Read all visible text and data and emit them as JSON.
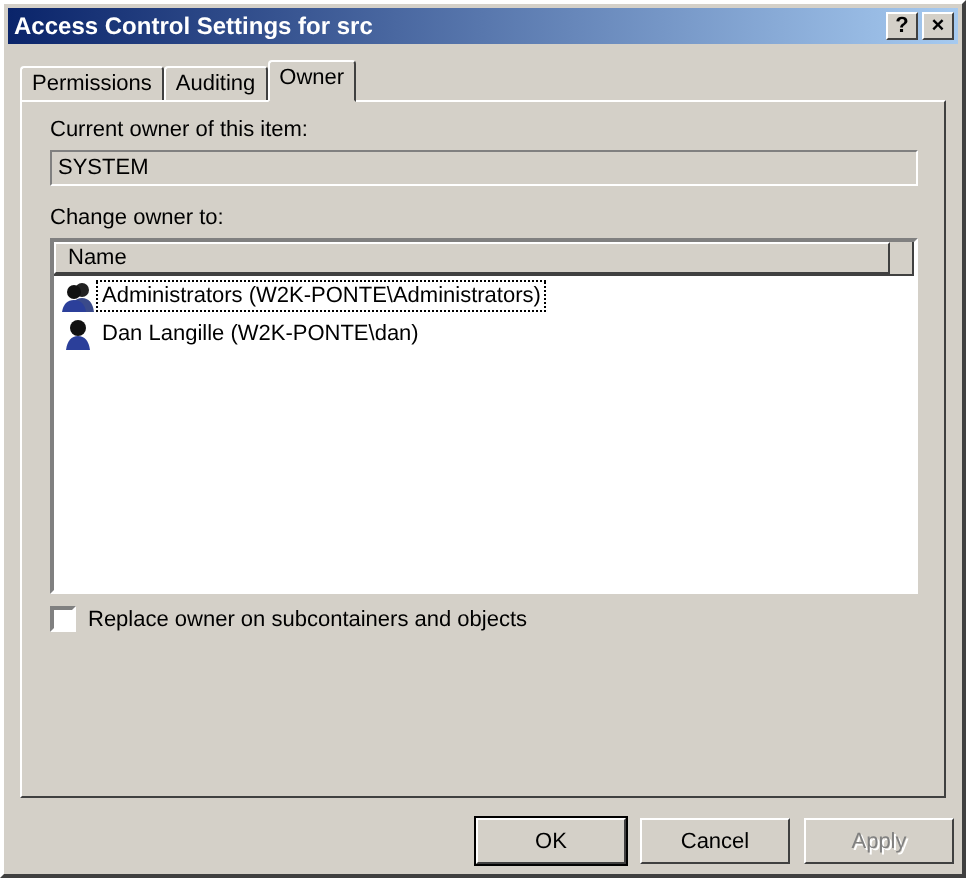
{
  "window": {
    "title": "Access Control Settings for src",
    "buttons": [
      "?",
      "×"
    ]
  },
  "tabs": [
    {
      "label": "Permissions",
      "selected": false
    },
    {
      "label": "Auditing",
      "selected": false
    },
    {
      "label": "Owner",
      "selected": true
    }
  ],
  "current_owner": {
    "label": "Current owner of this item:",
    "value": "SYSTEM"
  },
  "change_owner": {
    "label": "Change owner to:",
    "columns": [
      "Name"
    ],
    "items": [
      {
        "name": "Administrators (W2K-PONTE\\Administrators)",
        "kind": "group",
        "focused": true
      },
      {
        "name": "Dan Langille (W2K-PONTE\\dan)",
        "kind": "user",
        "focused": false
      }
    ]
  },
  "replace_option": {
    "label": "Replace owner on subcontainers and objects",
    "checked": false
  },
  "buttons": [
    {
      "label": "OK",
      "default": true,
      "disabled": false
    },
    {
      "label": "Cancel",
      "default": false,
      "disabled": false
    },
    {
      "label": "Apply",
      "default": false,
      "disabled": true
    }
  ]
}
